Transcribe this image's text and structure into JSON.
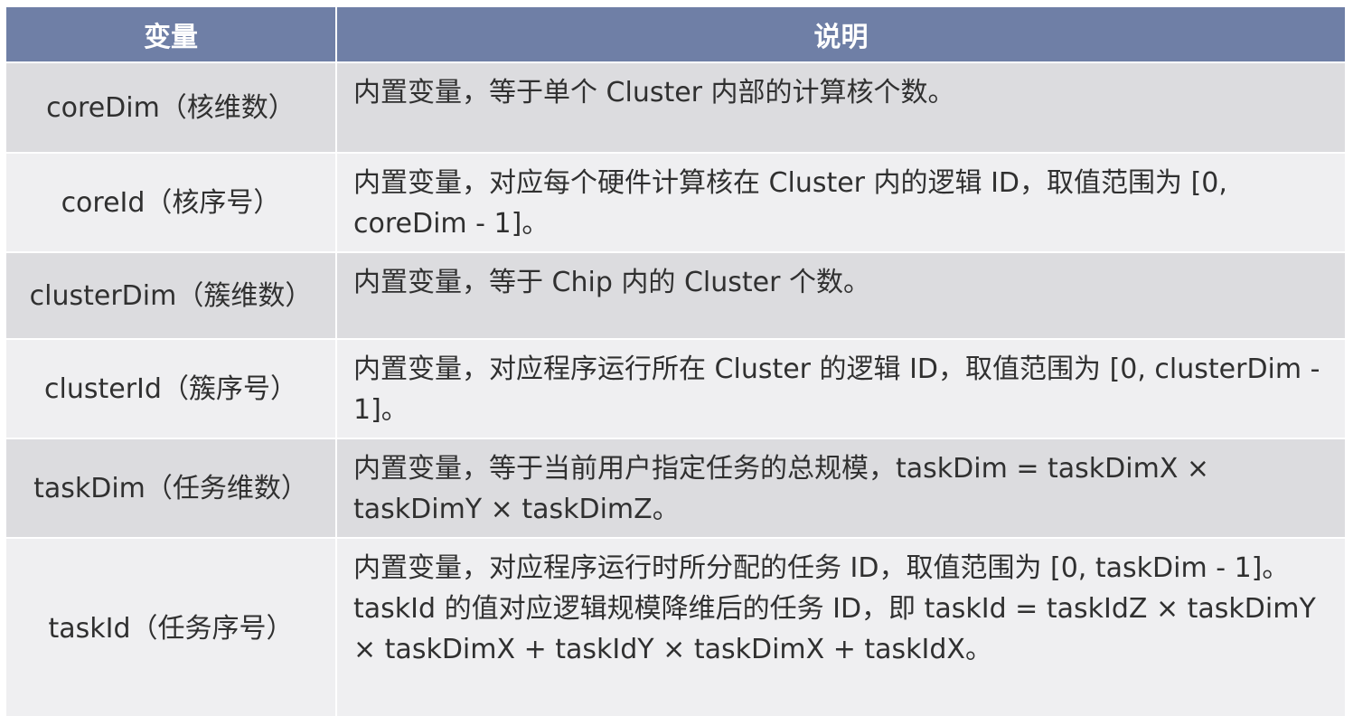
{
  "table": {
    "headers": [
      "变量",
      "说明"
    ],
    "rows": [
      {
        "variable": "coreDim（核维数）",
        "description": "内置变量，等于单个 Cluster 内部的计算核个数。"
      },
      {
        "variable": "coreId（核序号）",
        "description": "内置变量，对应每个硬件计算核在 Cluster 内的逻辑 ID，取值范围为 [0, coreDim - 1]。"
      },
      {
        "variable": "clusterDim（簇维数）",
        "description": "内置变量，等于 Chip 内的 Cluster 个数。"
      },
      {
        "variable": "clusterId（簇序号）",
        "description": "内置变量，对应程序运行所在 Cluster 的逻辑 ID，取值范围为 [0, clusterDim - 1]。"
      },
      {
        "variable": "taskDim（任务维数）",
        "description": "内置变量，等于当前用户指定任务的总规模，taskDim = taskDimX × taskDimY × taskDimZ。"
      },
      {
        "variable": "taskId（任务序号）",
        "description": "内置变量，对应程序运行时所分配的任务 ID，取值范围为 [0, taskDim - 1]。taskId 的值对应逻辑规模降维后的任务 ID，即 taskId = taskIdZ × taskDimY × taskDimX + taskIdY × taskDimX + taskIdX。"
      }
    ]
  }
}
